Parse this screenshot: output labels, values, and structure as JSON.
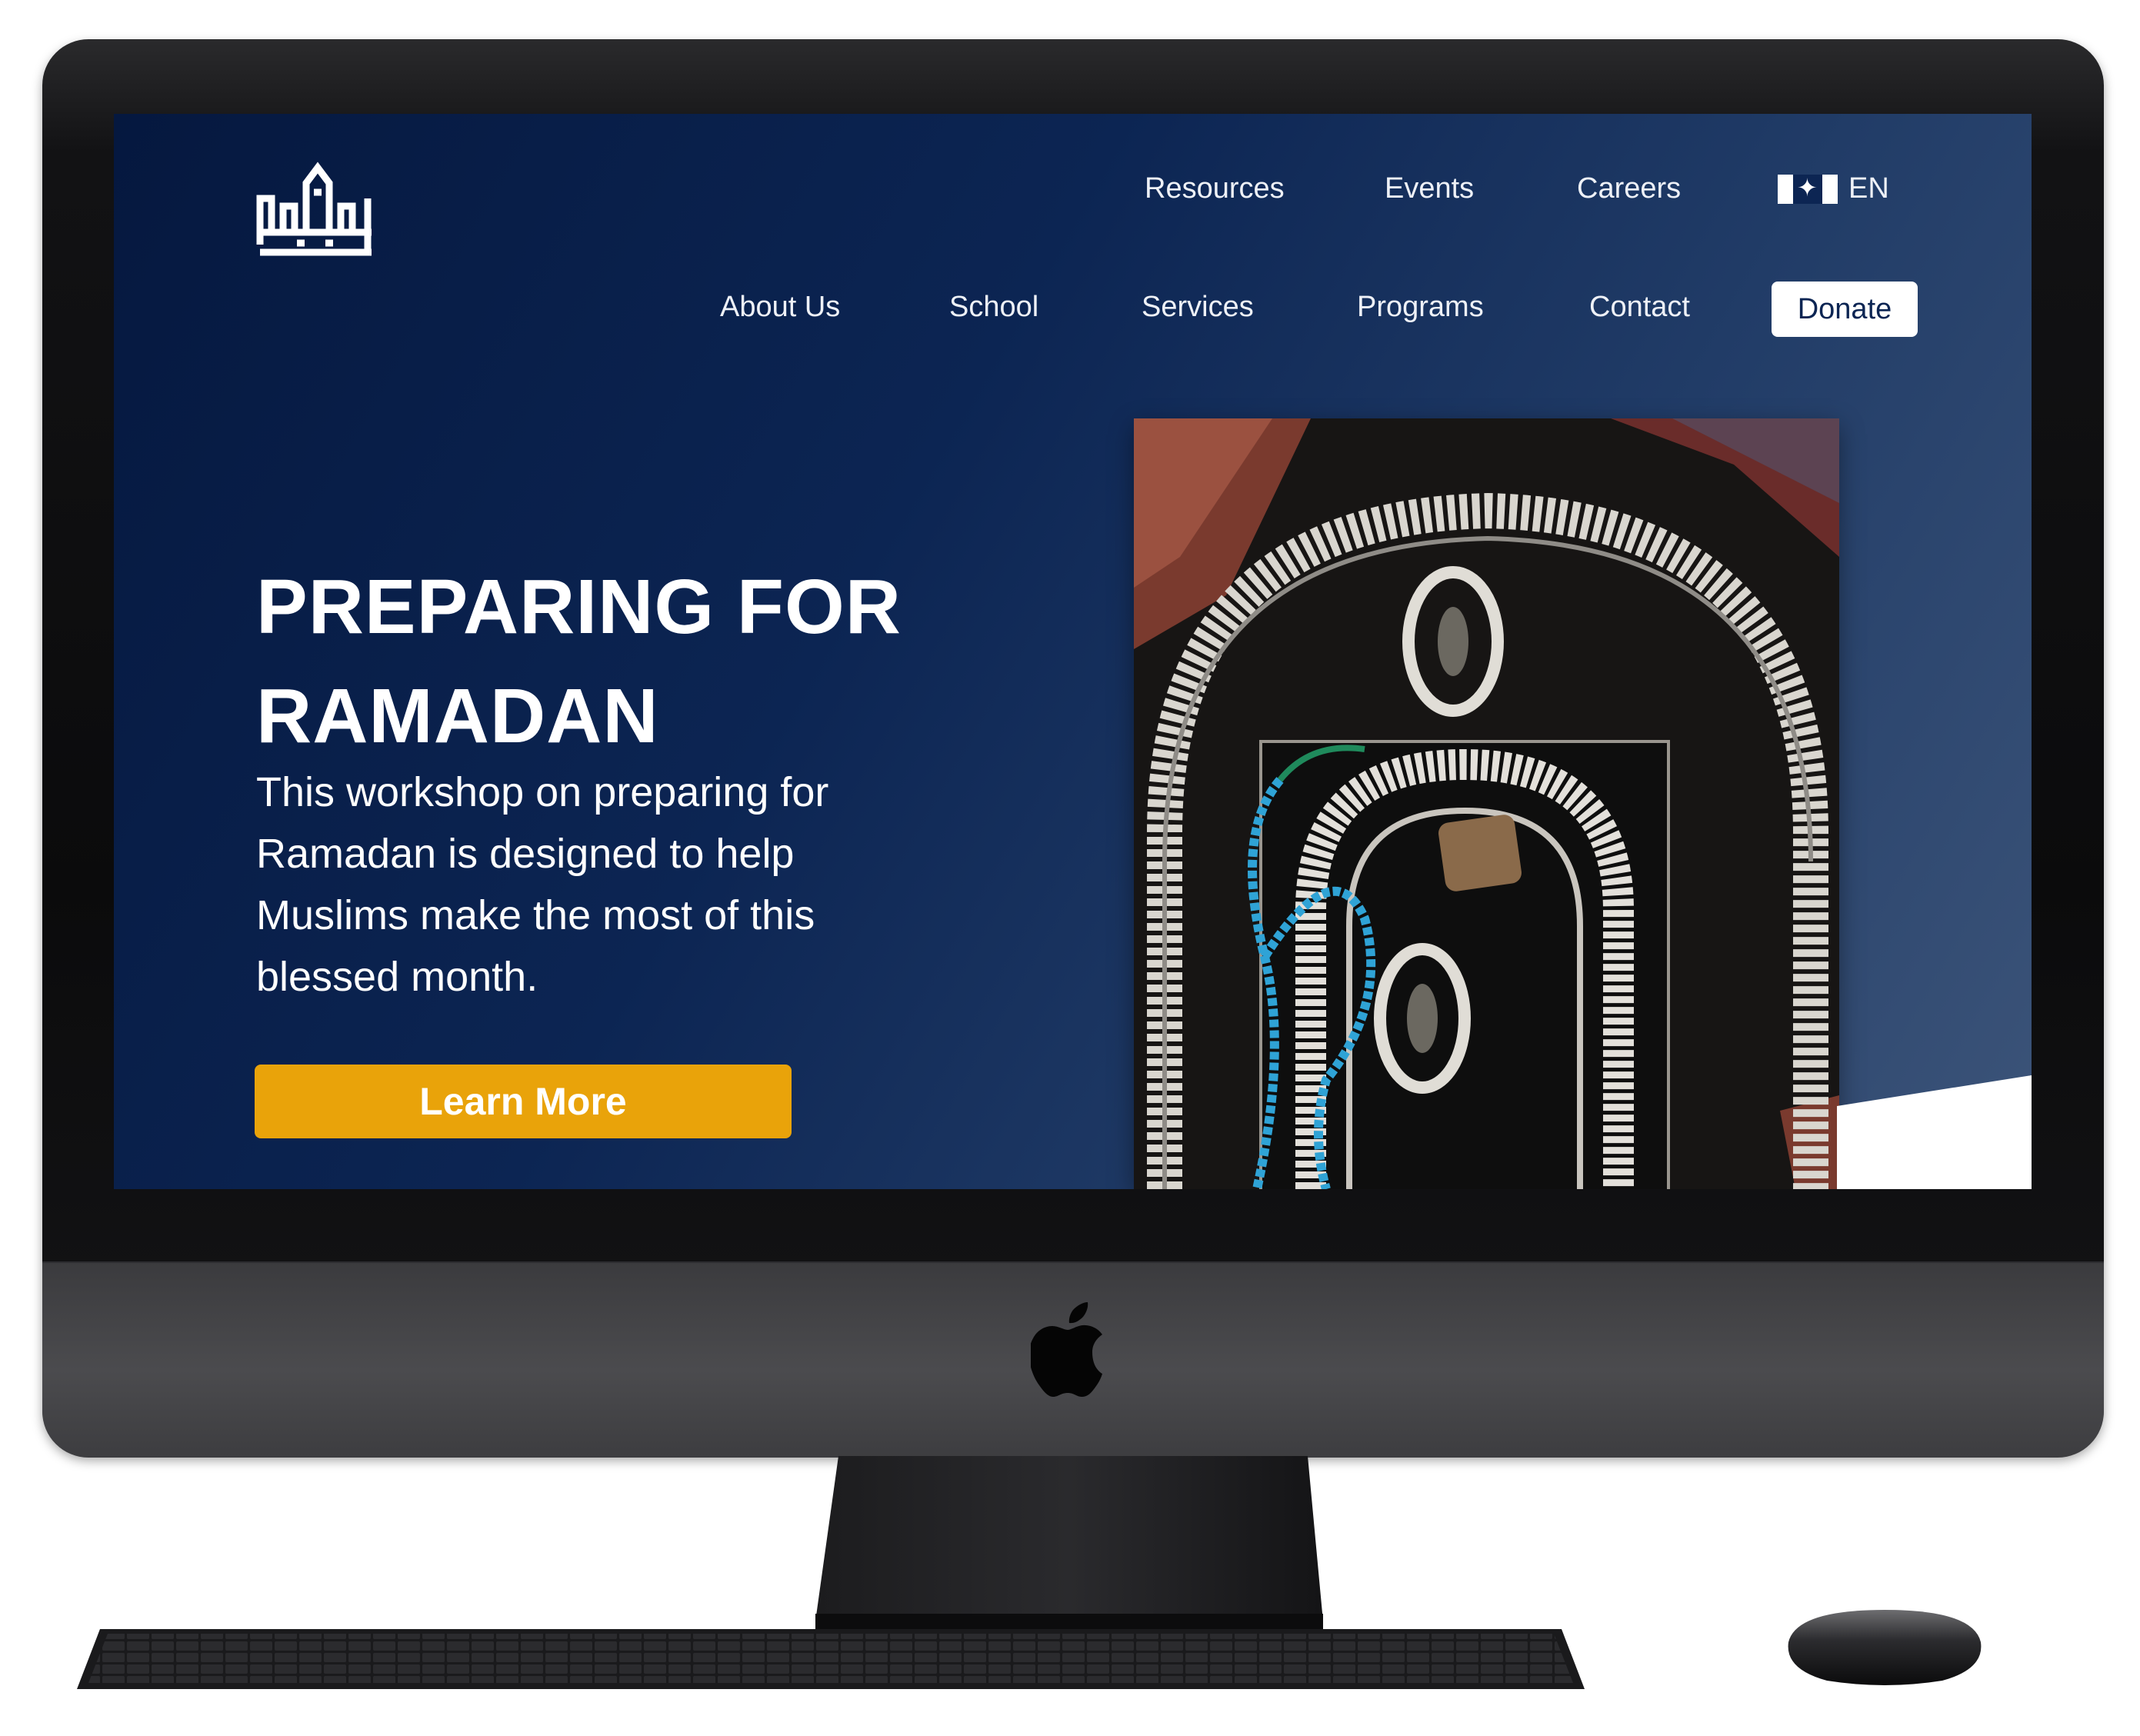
{
  "nav": {
    "top": [
      {
        "label": "Resources"
      },
      {
        "label": "Events"
      },
      {
        "label": "Careers"
      }
    ],
    "language": {
      "code": "EN",
      "flag_icon": "canada-flag-icon"
    },
    "main": [
      {
        "label": "About Us"
      },
      {
        "label": "School"
      },
      {
        "label": "Services"
      },
      {
        "label": "Programs"
      },
      {
        "label": "Contact"
      }
    ],
    "donate_label": "Donate"
  },
  "hero": {
    "title": "PREPARING FOR RAMADAN",
    "description": "This workshop on preparing for Ramadan is designed to help Muslims make the most of this blessed month.",
    "cta_label": "Learn More"
  },
  "colors": {
    "background_start": "#05183f",
    "background_end": "#3c5479",
    "cta": "#e9a30a",
    "donate_bg": "#ffffff",
    "text": "#ffffff"
  },
  "icons": [
    "mosque-logo-icon",
    "canada-flag-icon",
    "apple-logo-icon"
  ]
}
